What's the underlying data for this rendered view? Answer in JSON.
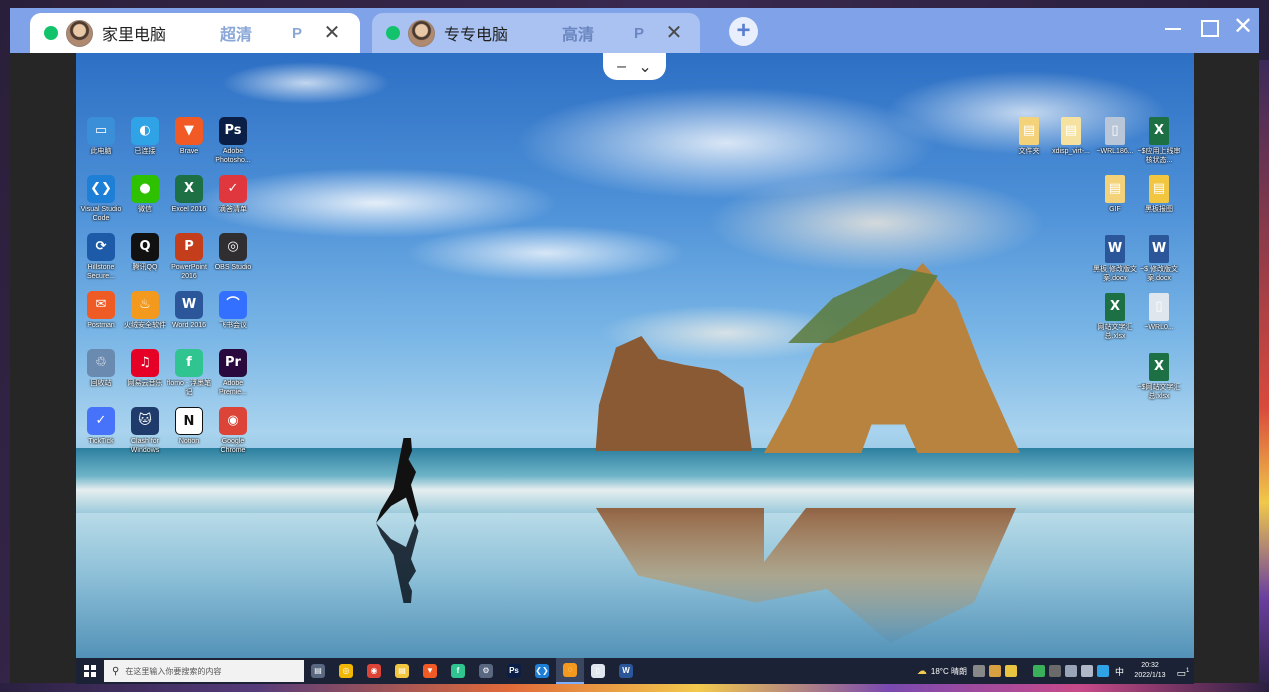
{
  "tabs": [
    {
      "name": "家里电脑",
      "quality": "超清",
      "p": "P",
      "close": "✕"
    },
    {
      "name": "专专电脑",
      "quality": "高清",
      "p": "P",
      "close": "✕"
    }
  ],
  "new_tab": "+",
  "window_controls": {
    "close": "✕"
  },
  "handle": {
    "minus": "–",
    "chevron": "⌄"
  },
  "desktop_left": [
    {
      "label": "此电脑",
      "icon": "computer-icon",
      "color": "#3b8ed8",
      "glyph": "▭"
    },
    {
      "label": "已连接",
      "icon": "cloud-icon",
      "color": "#2fa3e6",
      "glyph": "◐"
    },
    {
      "label": "Brave",
      "icon": "brave-icon",
      "color": "#f15a24",
      "glyph": "▼"
    },
    {
      "label": "Adobe Photosho...",
      "icon": "photoshop-icon",
      "color": "#0b1e45",
      "glyph": "Ps"
    },
    {
      "label": "Visual Studio Code",
      "icon": "vscode-icon",
      "color": "#1e7fd6",
      "glyph": "❮❯"
    },
    {
      "label": "微信",
      "icon": "wechat-icon",
      "color": "#2dc100",
      "glyph": "●"
    },
    {
      "label": "Excel 2016",
      "icon": "excel-icon",
      "color": "#1d7044",
      "glyph": "X"
    },
    {
      "label": "滴答清单",
      "icon": "tick-icon",
      "color": "#e0363d",
      "glyph": "✓"
    },
    {
      "label": "Hillstone Secure...",
      "icon": "hillstone-icon",
      "color": "#1d5aa8",
      "glyph": "⟳"
    },
    {
      "label": "腾讯QQ",
      "icon": "qq-icon",
      "color": "#111111",
      "glyph": "Q"
    },
    {
      "label": "PowerPoint 2016",
      "icon": "powerpoint-icon",
      "color": "#c43e1c",
      "glyph": "P"
    },
    {
      "label": "OBS Studio",
      "icon": "obs-icon",
      "color": "#302e31",
      "glyph": "◎"
    },
    {
      "label": "Postman",
      "icon": "postman-icon",
      "color": "#ef5b25",
      "glyph": "✉"
    },
    {
      "label": "火绒安全软件",
      "icon": "huorong-icon",
      "color": "#f39a1e",
      "glyph": "♨"
    },
    {
      "label": "Word 2016",
      "icon": "word-icon",
      "color": "#2b579a",
      "glyph": "W"
    },
    {
      "label": "飞书会议",
      "icon": "lark-icon",
      "color": "#3370ff",
      "glyph": "⌒"
    },
    {
      "label": "回收站",
      "icon": "recycle-bin-icon",
      "color": "#6a8ab0",
      "glyph": "♲"
    },
    {
      "label": "网易云音乐",
      "icon": "netease-music-icon",
      "color": "#e60026",
      "glyph": "♫"
    },
    {
      "label": "flomo - 浮墨笔记",
      "icon": "flomo-icon",
      "color": "#30c490",
      "glyph": "f"
    },
    {
      "label": "Adobe Premie...",
      "icon": "premiere-icon",
      "color": "#2a0a3e",
      "glyph": "Pr"
    },
    {
      "label": "TickTick",
      "icon": "ticktick-icon",
      "color": "#4772fa",
      "glyph": "✓"
    },
    {
      "label": "Clash for Windows",
      "icon": "clash-icon",
      "color": "#1f3b6b",
      "glyph": "🐱"
    },
    {
      "label": "Notion",
      "icon": "notion-icon",
      "color": "#ffffff",
      "glyph": "N"
    },
    {
      "label": "Google Chrome",
      "icon": "chrome-icon",
      "color": "#db4437",
      "glyph": "◉"
    }
  ],
  "desktop_right": [
    {
      "label": "文件夹",
      "icon": "folder-icon",
      "color": "#f3d27a",
      "glyph": "▤"
    },
    {
      "label": "xdisp_virt-...",
      "icon": "file-icon",
      "color": "#f6e2a0",
      "glyph": "▤"
    },
    {
      "label": "~WRL186...",
      "icon": "file-icon",
      "color": "#b8c6d8",
      "glyph": "▯"
    },
    {
      "label": "~$应用上线审核状态...",
      "icon": "excel-file-icon",
      "color": "#1d7044",
      "glyph": "X"
    },
    {
      "label": "GIF",
      "icon": "gif-folder-icon",
      "color": "#f3d27a",
      "glyph": "▤"
    },
    {
      "label": "黑板报图",
      "icon": "folder-icon",
      "color": "#f3c640",
      "glyph": "▤"
    },
    {
      "label": "黑板 修改版文案.docx",
      "icon": "word-file-icon",
      "color": "#2b579a",
      "glyph": "W"
    },
    {
      "label": "~$ 修改版文案.docx",
      "icon": "word-file-icon",
      "color": "#2b579a",
      "glyph": "W"
    },
    {
      "label": "网站文字汇总.xlsx",
      "icon": "excel-file-icon",
      "color": "#1d7044",
      "glyph": "X"
    },
    {
      "label": "~WRL0...",
      "icon": "file-icon",
      "color": "#dfe6ee",
      "glyph": "▯"
    },
    {
      "label": "~$网站文字汇总.xlsx",
      "icon": "excel-file-icon",
      "color": "#1d7044",
      "glyph": "X"
    }
  ],
  "taskbar": {
    "search_placeholder": "在这里输入你要搜索的内容",
    "apps": [
      {
        "icon": "task-view-icon",
        "color": "#5a6780",
        "glyph": "▤"
      },
      {
        "icon": "360-browser-icon",
        "color": "#f2b705",
        "glyph": "◎"
      },
      {
        "icon": "chrome-icon",
        "color": "#db4437",
        "glyph": "◉"
      },
      {
        "icon": "file-explorer-icon",
        "color": "#f3c640",
        "glyph": "▤"
      },
      {
        "icon": "brave-icon",
        "color": "#f15a24",
        "glyph": "▼"
      },
      {
        "icon": "flomo-icon",
        "color": "#30c490",
        "glyph": "f"
      },
      {
        "icon": "settings-icon",
        "color": "#5a6780",
        "glyph": "⚙"
      },
      {
        "icon": "photoshop-icon",
        "color": "#0b1e45",
        "glyph": "Ps"
      },
      {
        "icon": "vscode-icon",
        "color": "#1e7fd6",
        "glyph": "❮❯"
      },
      {
        "icon": "remote-desktop-icon",
        "color": "#f39a1e",
        "glyph": "◌",
        "active": true
      },
      {
        "icon": "notepad-icon",
        "color": "#dfe6ee",
        "glyph": "▯"
      },
      {
        "icon": "word-icon",
        "color": "#2b579a",
        "glyph": "W"
      }
    ],
    "weather": "18°C 晴朗",
    "lang": "中",
    "time": "20:32",
    "date": "2022/1/13",
    "notify": "1"
  }
}
